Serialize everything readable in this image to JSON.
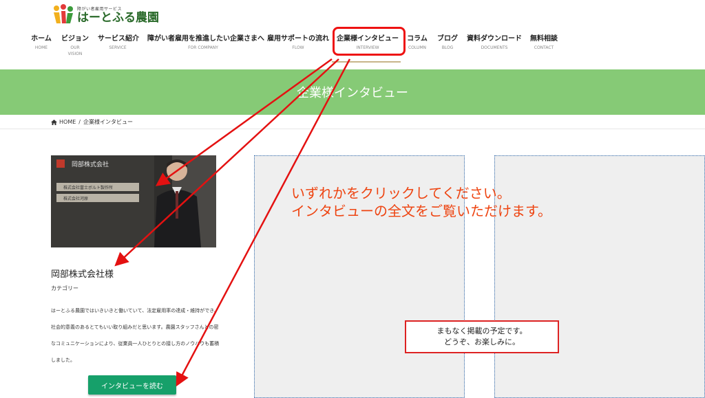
{
  "logo": {
    "tagline": "障がい者雇用サービス",
    "name": "はーとふる農園",
    "icon": "logo-hands-icon"
  },
  "nav": [
    {
      "label": "ホーム",
      "sub": "HOME"
    },
    {
      "label": "ビジョン",
      "sub": "OUR VISION"
    },
    {
      "label": "サービス紹介",
      "sub": "SERVICE"
    },
    {
      "label": "障がい者雇用を推進したい企業さまへ",
      "sub": "FOR COMPANY"
    },
    {
      "label": "雇用サポートの流れ",
      "sub": "FLOW"
    },
    {
      "label": "企業様インタビュー",
      "sub": "INTERVIEW"
    },
    {
      "label": "コラム",
      "sub": "COLUMN"
    },
    {
      "label": "ブログ",
      "sub": "BLOG"
    },
    {
      "label": "資料ダウンロード",
      "sub": "DOCUMENTS"
    },
    {
      "label": "無料相談",
      "sub": "CONTACT"
    }
  ],
  "banner": {
    "title": "企業様インタビュー"
  },
  "breadcrumb": {
    "home": "HOME",
    "separator": "/",
    "current": "企業様インタビュー"
  },
  "card": {
    "title": "岡部株式会社様",
    "category": "カテゴリー",
    "description": "はーとふる農園ではいきいきと働いていて、法定雇用率の達成・維持ができ、社会的意義のあるとてもいい取り組みだと思います。農園スタッフさんとの密なコミュニケーションにより、従業員一人ひとりとの接し方のノウハウも蓄積しました。",
    "button": "インタビューを読む",
    "photo_sign": "岡部株式会社",
    "photo_plates": [
      "株式会社富士ボルト製作所",
      "株式会社河原"
    ]
  },
  "annotation": {
    "line1": "いずれかをクリックしてください。",
    "line2": "インタビューの全文をご覧いただけます。"
  },
  "notice": {
    "line1": "まもなく掲載の予定です。",
    "line2": "どうぞ、お楽しみに。"
  },
  "colors": {
    "banner": "#86ca76",
    "button": "#16a06a",
    "annotation": "#e41111"
  }
}
